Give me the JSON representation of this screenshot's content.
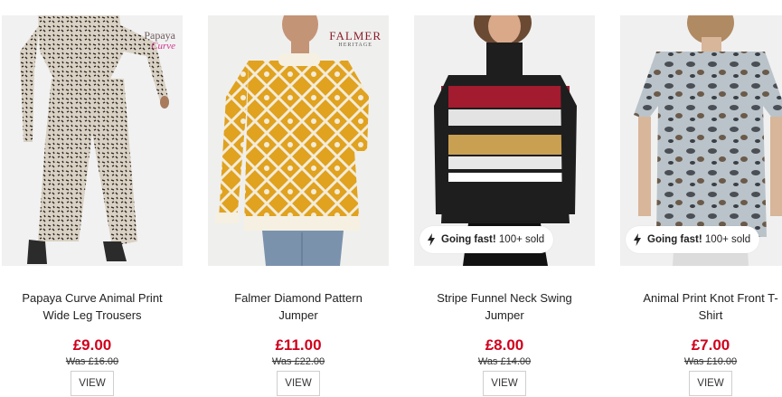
{
  "products": [
    {
      "name_line1": "Papaya Curve Animal Print",
      "name_line2": "Wide Leg Trousers",
      "price": "£9.00",
      "was": "Was £16.00",
      "view": "VIEW",
      "brand_logo_line1": "Papaya",
      "brand_logo_line2": "Curve",
      "badge": null
    },
    {
      "name_line1": "Falmer Diamond Pattern",
      "name_line2": "Jumper",
      "price": "£11.00",
      "was": "Was £22.00",
      "view": "VIEW",
      "brand_logo_line1": "FALMER",
      "brand_logo_line2": "HERITAGE",
      "badge": null
    },
    {
      "name_line1": "Stripe Funnel Neck Swing",
      "name_line2": "Jumper",
      "price": "£8.00",
      "was": "Was £14.00",
      "view": "VIEW",
      "badge": {
        "strong": "Going fast!",
        "text": "100+ sold"
      }
    },
    {
      "name_line1": "Animal Print Knot Front T-",
      "name_line2": "Shirt",
      "price": "£7.00",
      "was": "Was £10.00",
      "view": "VIEW",
      "badge": {
        "strong": "Going fast!",
        "text": "100+ sold"
      }
    }
  ],
  "colors": {
    "price_red": "#d0001c",
    "image_bg": "#ececec"
  },
  "icons": {
    "badge_icon": "lightning-bolt-icon"
  }
}
